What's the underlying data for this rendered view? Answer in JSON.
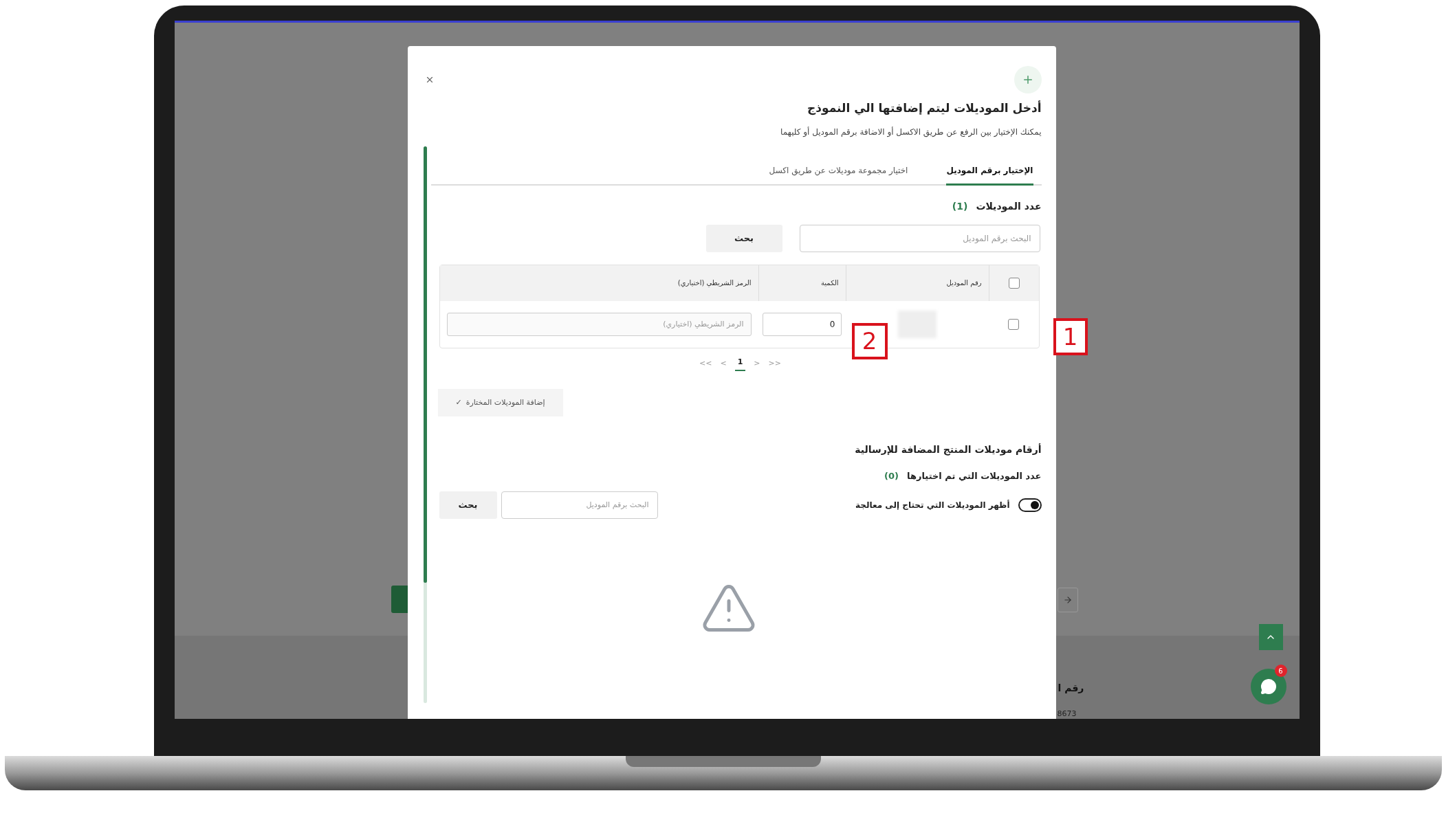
{
  "modal": {
    "title": "أدخل الموديلات ليتم إضافتها الي النموذج",
    "subtitle": "يمكنك الإختيار بين الرفع عن طريق الاكسل أو الاضافة برقم الموديل أو كليهما",
    "tabs": [
      {
        "label": "الإختيار برقم الموديل",
        "selected": true
      },
      {
        "label": "اختيار مجموعة موديلات عن طريق اكسل",
        "selected": false
      }
    ],
    "models_count": {
      "label": "عدد الموديلات",
      "count": "(1)"
    },
    "search": {
      "placeholder": "البحث برقم الموديل",
      "button": "بحث"
    },
    "table": {
      "header_checked": false,
      "columns": [
        "رقم الموديل",
        "الكمية",
        "الرمز الشريطي (اختياري)"
      ],
      "rows": [
        {
          "checked": false,
          "quantity": "0",
          "barcode_placeholder": "الرمز الشريطي (اختياري)"
        }
      ]
    },
    "pagination": {
      "first": "<<",
      "prev": "<",
      "pages": [
        {
          "label": "1",
          "selected": true
        }
      ],
      "next": ">",
      "last": ">>"
    },
    "add_button": {
      "icon": "✓",
      "label": "إضافة الموديلات المختارة"
    },
    "added_section": {
      "title": "أرقام موديلات المنتج المضافة للإرسالية",
      "count_label": "عدد الموديلات التي تم اختيارها",
      "count": "(0)",
      "toggle": {
        "label": "أظهر الموديلات التي تحتاج إلى معالجة",
        "on": true
      },
      "search": {
        "placeholder": "البحث برقم الموديل",
        "button": "بحث"
      }
    }
  },
  "annotations": [
    "1",
    "2"
  ],
  "background": {
    "texts": [
      "رقم ا",
      "8673"
    ],
    "chat_badge": "6"
  }
}
